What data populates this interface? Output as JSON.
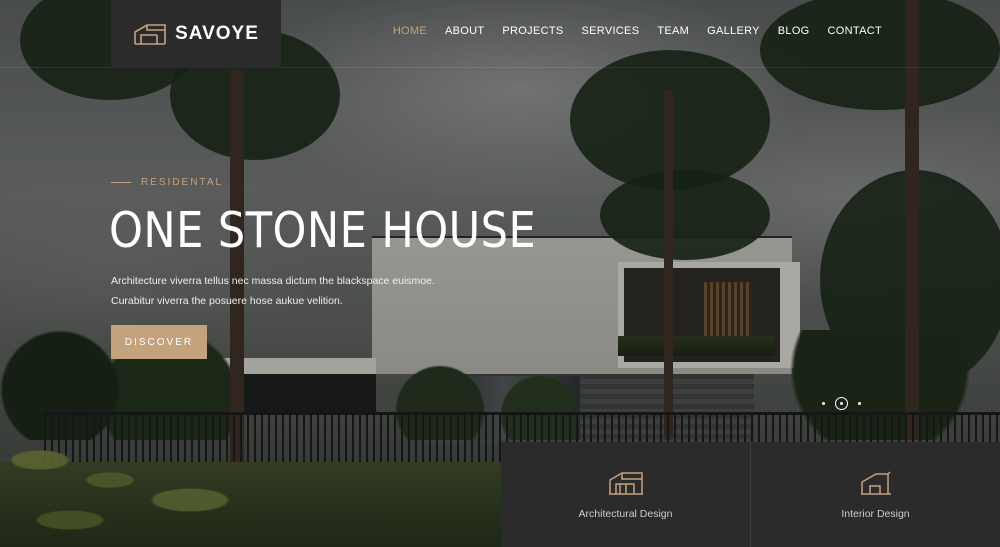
{
  "brand": {
    "name": "SAVOYE",
    "logo_icon": "house-outline-icon"
  },
  "nav": {
    "items": [
      {
        "label": "HOME",
        "active": true
      },
      {
        "label": "ABOUT",
        "active": false
      },
      {
        "label": "PROJECTS",
        "active": false
      },
      {
        "label": "SERVICES",
        "active": false
      },
      {
        "label": "TEAM",
        "active": false
      },
      {
        "label": "GALLERY",
        "active": false
      },
      {
        "label": "BLOG",
        "active": false
      },
      {
        "label": "CONTACT",
        "active": false
      }
    ]
  },
  "hero": {
    "eyebrow": "RESIDENTAL",
    "title": "ONE STONE HOUSE",
    "description_lines": [
      "Architecture viverra tellus nec massa dictum the blackspace euismoe.",
      "Curabitur viverra the posuere hose aukue velition."
    ],
    "cta_label": "DISCOVER"
  },
  "slider": {
    "slide_count": 3,
    "active_index": 1
  },
  "services": [
    {
      "label": "Architectural Design",
      "icon": "building-outline-icon"
    },
    {
      "label": "Interior Design",
      "icon": "interior-outline-icon"
    }
  ],
  "colors": {
    "accent": "#c4a27d",
    "panel": "#2b2b2b",
    "text": "#ffffff"
  }
}
